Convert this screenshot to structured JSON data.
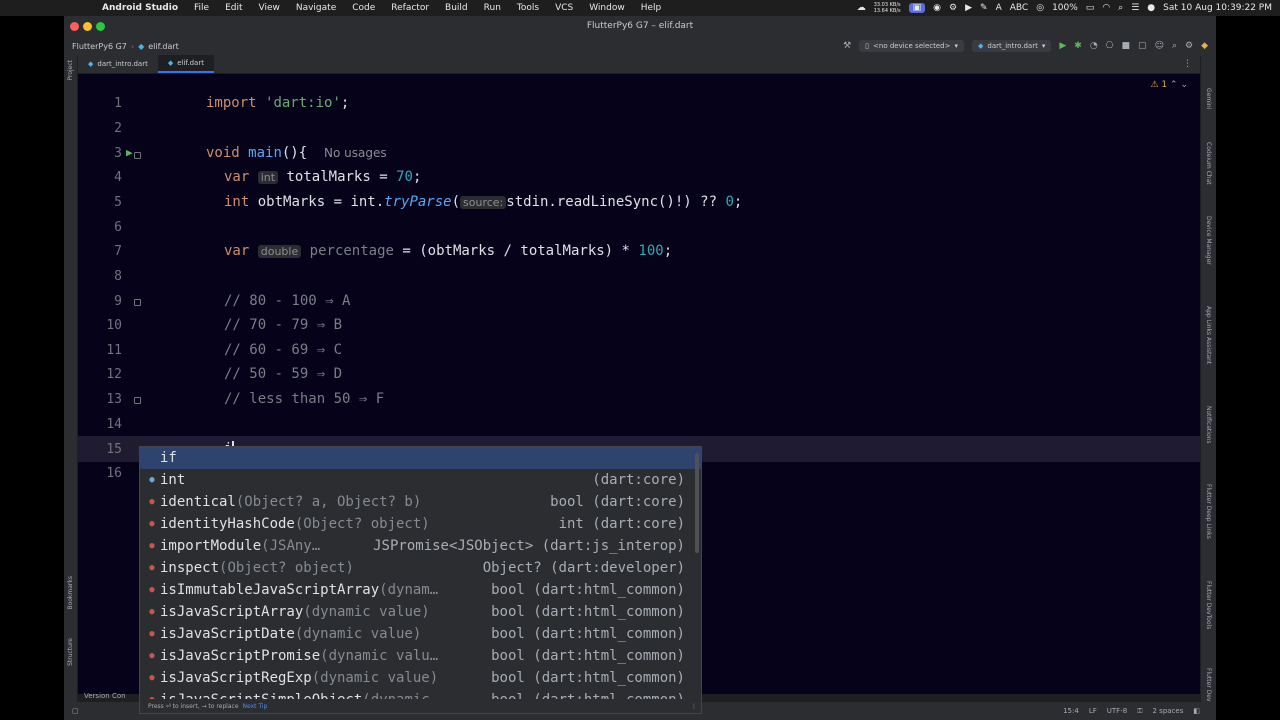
{
  "menubar": {
    "app": "Android Studio",
    "items": [
      "File",
      "Edit",
      "View",
      "Navigate",
      "Code",
      "Refactor",
      "Build",
      "Run",
      "Tools",
      "VCS",
      "Window",
      "Help"
    ],
    "net_up": "33.03 KB/s",
    "net_down": "13.64 KB/s",
    "input_source": "ABC",
    "battery": "100%",
    "datetime": "Sat 10 Aug  10:39:22 PM"
  },
  "window": {
    "title": "FlutterPy6 G7 – elif.dart",
    "breadcrumb_project": "FlutterPy6 G7",
    "breadcrumb_file": "elif.dart",
    "device_selector": "<no device selected>",
    "run_config": "dart_intro.dart"
  },
  "tabs": [
    {
      "label": "dart_intro.dart"
    },
    {
      "label": "elif.dart"
    }
  ],
  "editor": {
    "warning_count": "1",
    "line_numbers": [
      "1",
      "2",
      "3",
      "4",
      "5",
      "6",
      "7",
      "8",
      "9",
      "10",
      "11",
      "12",
      "13",
      "14",
      "15",
      "16"
    ],
    "l1_kw": "import",
    "l1_str": "'dart:io'",
    "l1_end": ";",
    "l3_kw": "void",
    "l3_fn": "main",
    "l3_rest": "(){",
    "l3_usages": "No usages",
    "l4_kw": "var",
    "l4_hint": "int",
    "l4_name": " totalMarks = ",
    "l4_num": "70",
    "l4_end": ";",
    "l5_kw": "int",
    "l5_a": " obtMarks = int.",
    "l5_fn": "tryParse",
    "l5_b": "(",
    "l5_hint": "source:",
    "l5_c": "stdin.readLineSync()!) ?? ",
    "l5_num": "0",
    "l5_end": ";",
    "l7_kw": "var",
    "l7_hint": "double",
    "l7_name": " percentage",
    "l7_rest": " = (obtMarks / totalMarks) * ",
    "l7_num": "100",
    "l7_end": ";",
    "l9": "// 80 - 100 ⇒ A",
    "l10": "// 70 - 79 ⇒ B",
    "l11": "// 60 - 69 ⇒ C",
    "l12": "// 50 - 59 ⇒ D",
    "l13": "// less than 50 ⇒ F",
    "l15": "i"
  },
  "completion": {
    "items": [
      {
        "name": "if",
        "args": "",
        "type": ""
      },
      {
        "name": "int",
        "args": "",
        "type": "(dart:core)"
      },
      {
        "name": "identical",
        "args": "(Object? a, Object? b)",
        "type": "bool (dart:core)"
      },
      {
        "name": "identityHashCode",
        "args": "(Object? object)",
        "type": "int (dart:core)"
      },
      {
        "name": "importModule",
        "args": "(JSAny…",
        "type": "JSPromise<JSObject> (dart:js_interop)"
      },
      {
        "name": "inspect",
        "args": "(Object? object)",
        "type": "Object? (dart:developer)"
      },
      {
        "name": "isImmutableJavaScriptArray",
        "args": "(dynam…",
        "type": "bool (dart:html_common)"
      },
      {
        "name": "isJavaScriptArray",
        "args": "(dynamic value)",
        "type": "bool (dart:html_common)"
      },
      {
        "name": "isJavaScriptDate",
        "args": "(dynamic value)",
        "type": "bool (dart:html_common)"
      },
      {
        "name": "isJavaScriptPromise",
        "args": "(dynamic valu…",
        "type": "bool (dart:html_common)"
      },
      {
        "name": "isJavaScriptRegExp",
        "args": "(dynamic value)",
        "type": "bool (dart:html_common)"
      },
      {
        "name": "isJavaScriptSimpleObject",
        "args": "(dynamic…",
        "type": "bool (dart:html_common)"
      }
    ],
    "footer_hint": "Press ⏎ to insert, → to replace",
    "footer_link": "Next Tip"
  },
  "left_strip": {
    "project": "Project",
    "bookmarks": "Bookmarks",
    "structure": "Structure"
  },
  "right_strip": {
    "gemini": "Gemini",
    "codeium": "Codeium Chat",
    "device_manager": "Device Manager",
    "app_links": "App Links Assistant",
    "notifications": "Notifications",
    "flutter_deep_links": "Flutter Deep Links",
    "flutter_devtools": "Flutter DevTools",
    "flutter_dev": "Flutter Dev"
  },
  "statusbar": {
    "version_control": "Version Con",
    "position": "15:4",
    "line_sep": "LF",
    "encoding": "UTF-8",
    "indent": "2 spaces"
  },
  "colors": {
    "accent": "#3574f0",
    "editor_bg": "#05021a",
    "keyword": "#cf8e6d",
    "string": "#6aab73",
    "number": "#2aacb8"
  }
}
